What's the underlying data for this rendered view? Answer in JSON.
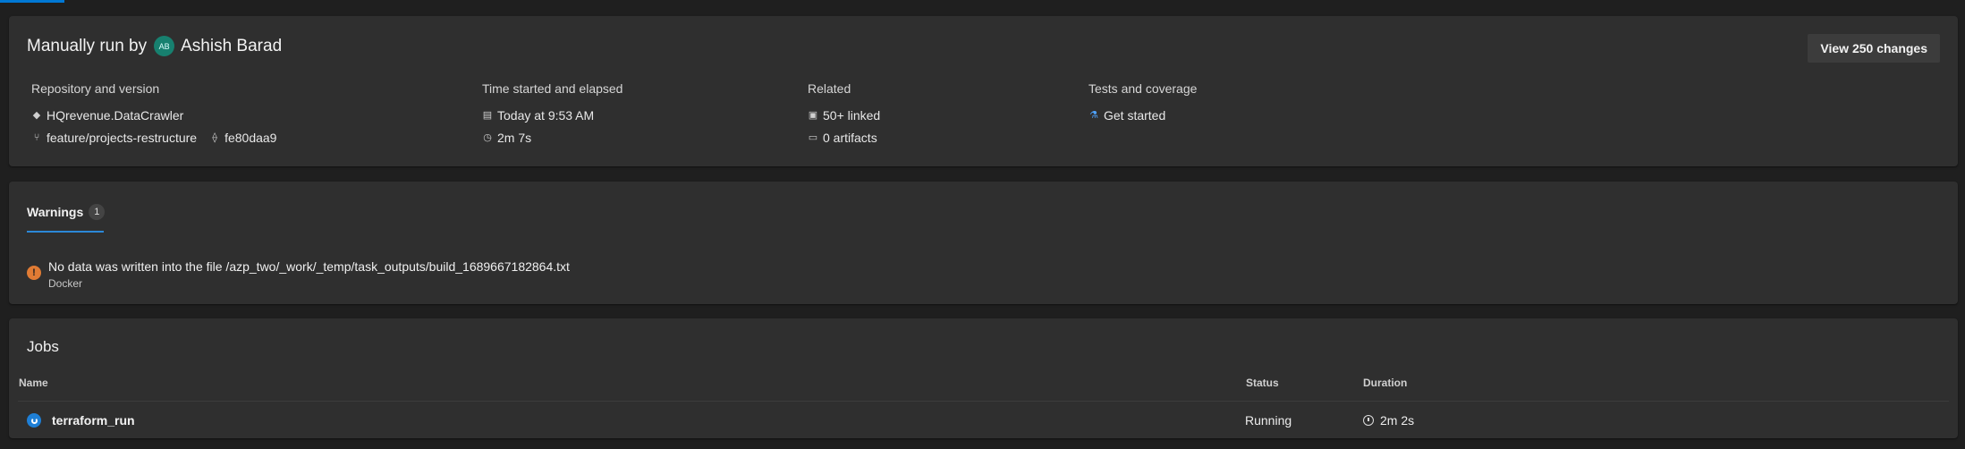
{
  "summary": {
    "run_prefix": "Manually run by",
    "avatar_initials": "AB",
    "user_name": "Ashish Barad",
    "view_changes_label": "View 250 changes",
    "repository": {
      "header": "Repository and version",
      "repo_name": "HQrevenue.DataCrawler",
      "branch": "feature/projects-restructure",
      "commit": "fe80daa9"
    },
    "time": {
      "header": "Time started and elapsed",
      "started": "Today at 9:53 AM",
      "elapsed": "2m 7s"
    },
    "related": {
      "header": "Related",
      "linked": "50+ linked",
      "artifacts": "0 artifacts"
    },
    "tests": {
      "header": "Tests and coverage",
      "link": "Get started"
    }
  },
  "warnings": {
    "tab_label": "Warnings",
    "count": "1",
    "items": [
      {
        "message": "No data was written into the file /azp_two/_work/_temp/task_outputs/build_1689667182864.txt",
        "source": "Docker"
      }
    ]
  },
  "jobs": {
    "title": "Jobs",
    "columns": {
      "name": "Name",
      "status": "Status",
      "duration": "Duration"
    },
    "rows": [
      {
        "name": "terraform_run",
        "status": "Running",
        "duration": "2m 2s"
      }
    ]
  },
  "colors": {
    "accent": "#0078d4",
    "warning": "#e07b34",
    "avatar": "#17806f",
    "link": "#4fa3ff"
  }
}
